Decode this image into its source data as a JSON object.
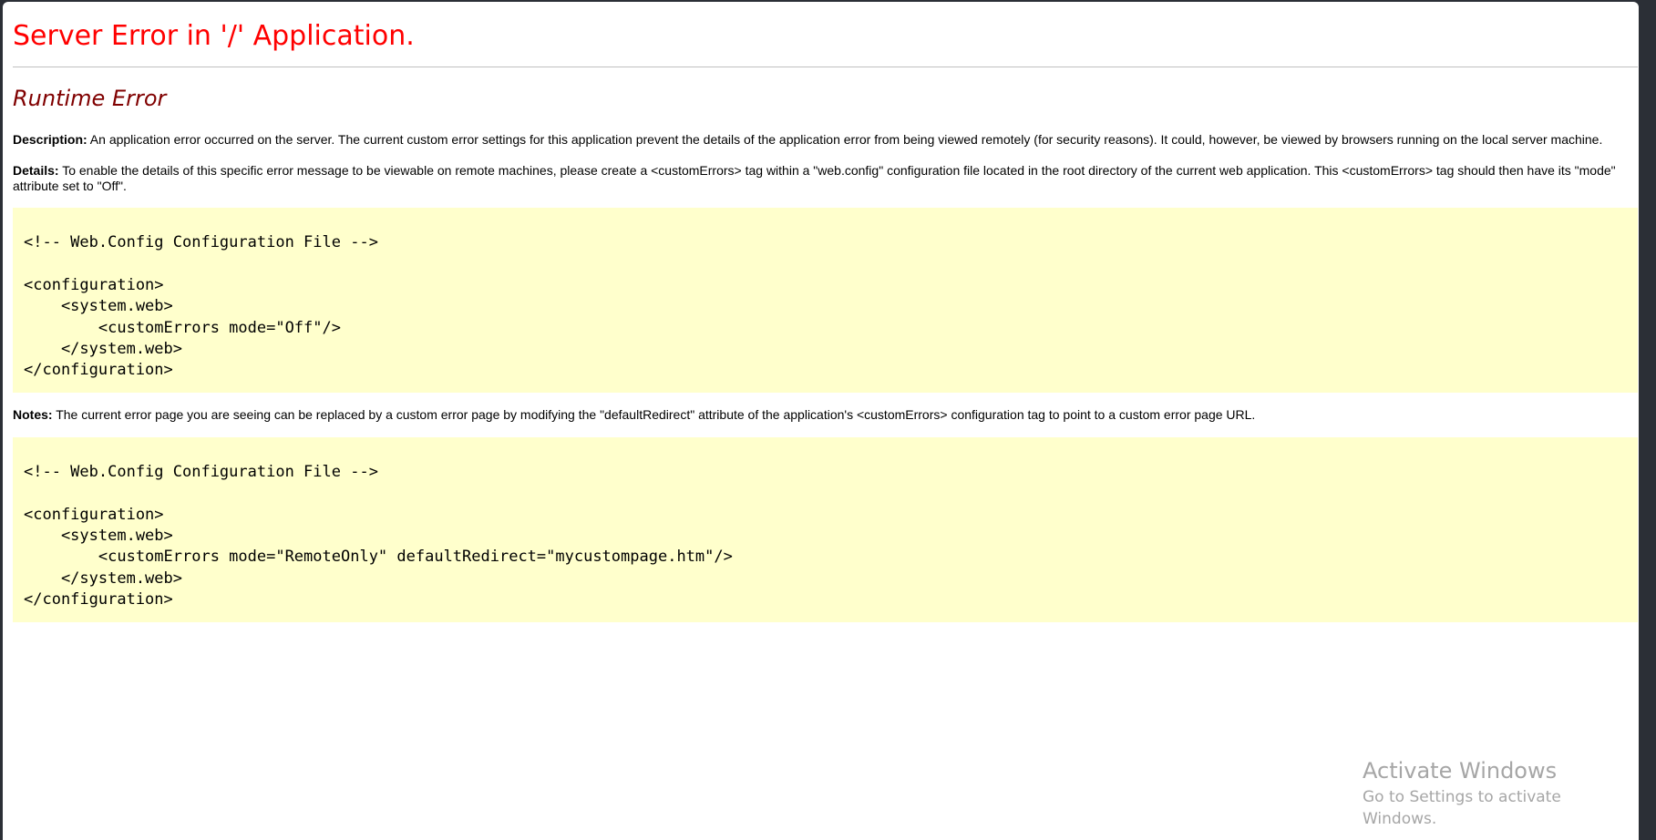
{
  "header": {
    "title": "Server Error in '/' Application.",
    "subtitle": "Runtime Error"
  },
  "description": {
    "label": "Description:",
    "text": " An application error occurred on the server. The current custom error settings for this application prevent the details of the application error from being viewed remotely (for security reasons). It could, however, be viewed by browsers running on the local server machine."
  },
  "details": {
    "label": "Details:",
    "text": " To enable the details of this specific error message to be viewable on remote machines, please create a <customErrors> tag within a \"web.config\" configuration file located in the root directory of the current web application. This <customErrors> tag should then have its \"mode\" attribute set to \"Off\"."
  },
  "code_block_1": "<!-- Web.Config Configuration File -->\n\n<configuration>\n    <system.web>\n        <customErrors mode=\"Off\"/>\n    </system.web>\n</configuration>",
  "notes": {
    "label": "Notes:",
    "text": " The current error page you are seeing can be replaced by a custom error page by modifying the \"defaultRedirect\" attribute of the application's <customErrors> configuration tag to point to a custom error page URL."
  },
  "code_block_2": "<!-- Web.Config Configuration File -->\n\n<configuration>\n    <system.web>\n        <customErrors mode=\"RemoteOnly\" defaultRedirect=\"mycustompage.htm\"/>\n    </system.web>\n</configuration>",
  "watermark": {
    "title": "Activate Windows",
    "subtitle": "Go to Settings to activate Windows."
  },
  "colors": {
    "title": "#ff0000",
    "subtitle": "#800000",
    "code_background": "#ffffcc",
    "watermark": "#a6a6a6"
  }
}
